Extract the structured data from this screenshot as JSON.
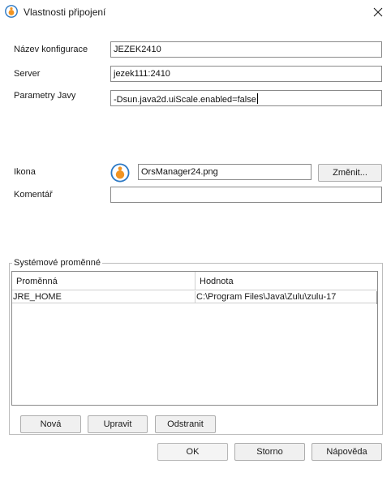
{
  "window": {
    "title": "Vlastnosti připojení",
    "close_symbol": "✕"
  },
  "form": {
    "config_name_label": "Název konfigurace",
    "config_name_value": "JEZEK2410",
    "server_label": "Server",
    "server_value": "jezek111:2410",
    "java_params_label": "Parametry Javy",
    "java_params_value": "-Dsun.java2d.uiScale.enabled=false",
    "icon_label": "Ikona",
    "icon_value": "OrsManager24.png",
    "change_button": "Změnit...",
    "comment_label": "Komentář",
    "comment_value": ""
  },
  "system_vars": {
    "group_title": "Systémové proměnné",
    "columns": [
      "Proměnná",
      "Hodnota"
    ],
    "rows": [
      [
        "JRE_HOME",
        "C:\\Program Files\\Java\\Zulu\\zulu-17"
      ]
    ],
    "buttons": {
      "new": "Nová",
      "edit": "Upravit",
      "remove": "Odstranit"
    }
  },
  "footer": {
    "ok": "OK",
    "cancel": "Storno",
    "help": "Nápověda"
  },
  "colors": {
    "icon_orange": "#f29422",
    "icon_blue": "#2b78c4",
    "border": "#8a8a8a"
  }
}
